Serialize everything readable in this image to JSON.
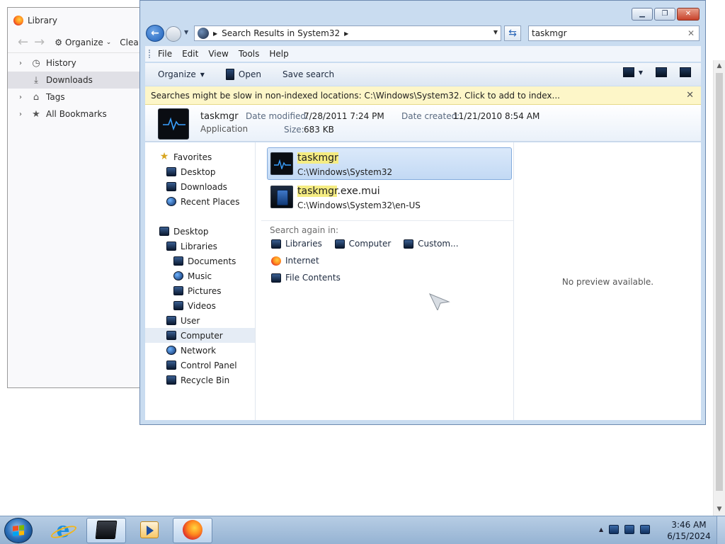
{
  "library_window": {
    "title": "Library",
    "toolbar": {
      "organize": "Organize",
      "organize_caret": "⌄",
      "clear": "Clea"
    },
    "tree": [
      {
        "label": "History"
      },
      {
        "label": "Downloads"
      },
      {
        "label": "Tags"
      },
      {
        "label": "All Bookmarks"
      }
    ]
  },
  "explorer": {
    "window_controls": {
      "minimize": "▁",
      "maximize": "❐",
      "close": "✕"
    },
    "address": {
      "crumb": "Search Results in System32"
    },
    "search": {
      "value": "taskmgr",
      "clear": "✕"
    },
    "menu": [
      "File",
      "Edit",
      "View",
      "Tools",
      "Help"
    ],
    "commands": {
      "organize": "Organize",
      "open": "Open",
      "save_search": "Save search"
    },
    "infobar": {
      "text": "Searches might be slow in non-indexed locations: C:\\Windows\\System32. Click to add to index...",
      "close": "✕"
    },
    "details": {
      "name": "taskmgr",
      "type": "Application",
      "date_modified_label": "Date modified:",
      "date_modified": "7/28/2011 7:24 PM",
      "date_created_label": "Date created:",
      "date_created": "11/21/2010 8:54 AM",
      "size_label": "Size:",
      "size": "683 KB"
    },
    "nav": {
      "favorites": "Favorites",
      "desktop_fav": "Desktop",
      "downloads": "Downloads",
      "recent_places": "Recent Places",
      "desktop": "Desktop",
      "libraries": "Libraries",
      "documents": "Documents",
      "music": "Music",
      "pictures": "Pictures",
      "videos": "Videos",
      "user": "User",
      "computer": "Computer",
      "network": "Network",
      "control_panel": "Control Panel",
      "recycle_bin": "Recycle Bin"
    },
    "results": [
      {
        "name_match": "taskmgr",
        "name_rest": "",
        "path": "C:\\Windows\\System32"
      },
      {
        "name_match": "taskmgr",
        "name_rest": ".exe.mui",
        "path": "C:\\Windows\\System32\\en-US"
      }
    ],
    "search_again": {
      "label": "Search again in:",
      "libraries": "Libraries",
      "computer": "Computer",
      "custom": "Custom...",
      "internet": "Internet",
      "file_contents": "File Contents"
    },
    "preview": {
      "message": "No preview available."
    }
  },
  "taskbar": {
    "time": "3:46 AM",
    "date": "6/15/2024"
  }
}
